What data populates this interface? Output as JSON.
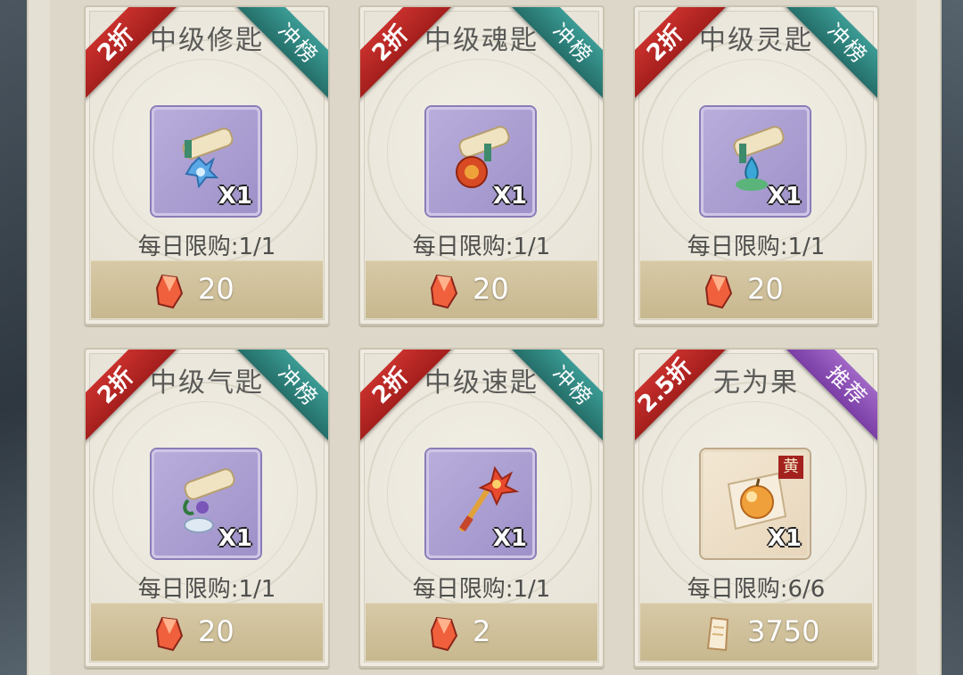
{
  "shop": {
    "cards": [
      {
        "title": "中级修匙",
        "discount": "2折",
        "tag": "冲榜",
        "tag_color": "#2f857f",
        "icon": "scroll-blue-flower-icon",
        "qty": "X1",
        "limit": "每日限购:1/1",
        "price": "20",
        "currency_icon": "red-crystal-icon"
      },
      {
        "title": "中级魂匙",
        "discount": "2折",
        "tag": "冲榜",
        "tag_color": "#2f857f",
        "icon": "scroll-red-orb-icon",
        "qty": "X1",
        "limit": "每日限购:1/1",
        "price": "20",
        "currency_icon": "red-crystal-icon"
      },
      {
        "title": "中级灵匙",
        "discount": "2折",
        "tag": "冲榜",
        "tag_color": "#2f857f",
        "icon": "scroll-teal-drop-icon",
        "qty": "X1",
        "limit": "每日限购:1/1",
        "price": "20",
        "currency_icon": "red-crystal-icon"
      },
      {
        "title": "中级气匙",
        "discount": "2折",
        "tag": "冲榜",
        "tag_color": "#2f857f",
        "icon": "scroll-green-cloud-icon",
        "qty": "X1",
        "limit": "每日限购:1/1",
        "price": "20",
        "currency_icon": "red-crystal-icon"
      },
      {
        "title": "中级速匙",
        "discount": "2折",
        "tag": "冲榜",
        "tag_color": "#2f857f",
        "icon": "golden-key-icon",
        "qty": "X1",
        "limit": "每日限购:1/1",
        "price": "2",
        "currency_icon": "red-crystal-icon"
      },
      {
        "title": "无为果",
        "discount": "2.5折",
        "tag": "推荐",
        "tag_color": "#8c4fb8",
        "icon": "golden-fruit-icon",
        "grade": "黄",
        "qty": "X1",
        "limit": "每日限购:6/6",
        "price": "3750",
        "currency_icon": "paper-ticket-icon"
      }
    ]
  }
}
